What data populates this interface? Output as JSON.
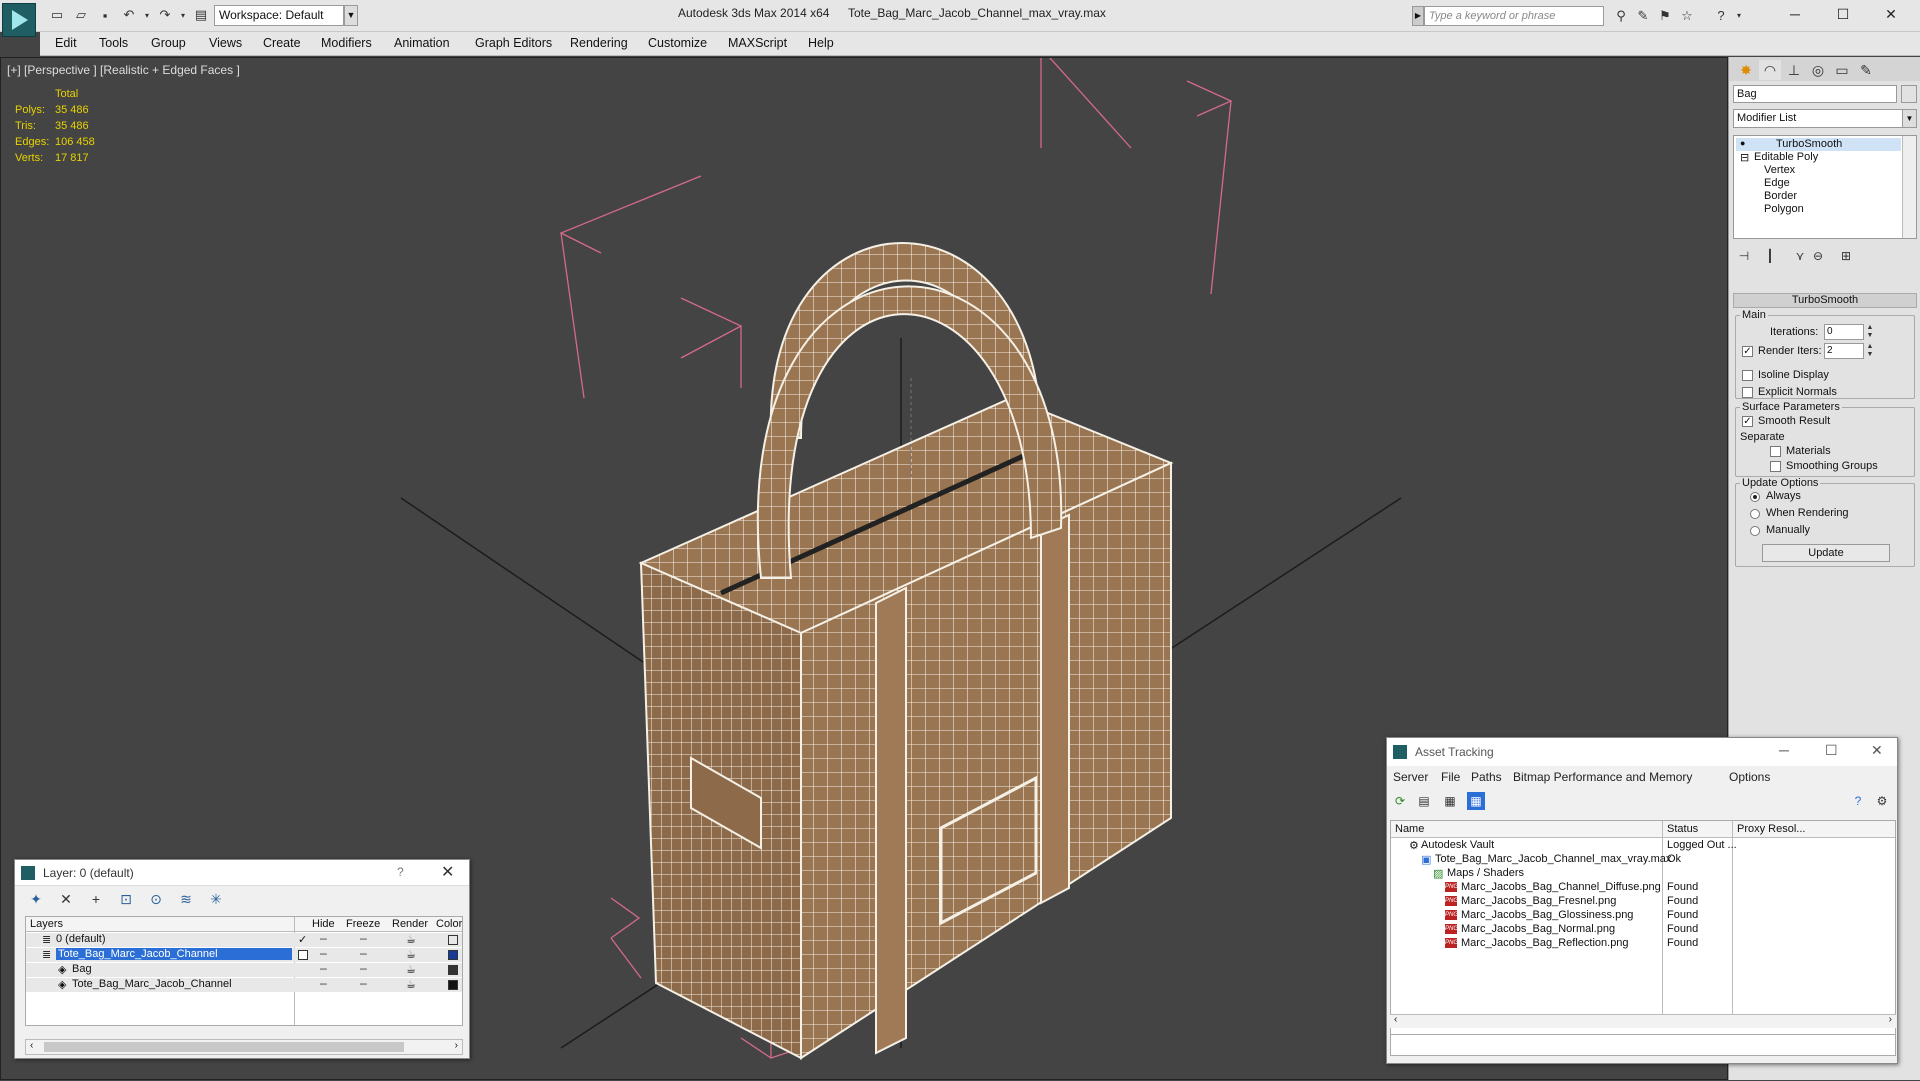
{
  "titlebar": {
    "workspace": "Workspace: Default",
    "app_title": "Autodesk 3ds Max  2014 x64",
    "doc_title": "Tote_Bag_Marc_Jacob_Channel_max_vray.max",
    "search_placeholder": "Type a keyword or phrase"
  },
  "menu": [
    "Edit",
    "Tools",
    "Group",
    "Views",
    "Create",
    "Modifiers",
    "Animation",
    "Graph Editors",
    "Rendering",
    "Customize",
    "MAXScript",
    "Help"
  ],
  "viewport": {
    "label": "[+] [Perspective ] [Realistic + Edged Faces ]",
    "stats_header": "Total",
    "stats": [
      {
        "k": "Polys:",
        "v": "35 486"
      },
      {
        "k": "Tris:",
        "v": "35 486"
      },
      {
        "k": "Edges:",
        "v": "106 458"
      },
      {
        "k": "Verts:",
        "v": "17 817"
      }
    ],
    "colors": {
      "bag": "#9a7552",
      "wire": "#f5f0e6",
      "bbox": "#d46a8a",
      "grid": "#1c1c1c"
    }
  },
  "command_panel": {
    "object_name": "Bag",
    "modifier_list": "Modifier List",
    "stack": [
      "TurboSmooth",
      "Editable Poly",
      "Vertex",
      "Edge",
      "Border",
      "Polygon"
    ],
    "rollout_title": "TurboSmooth",
    "main_label": "Main",
    "iterations_label": "Iterations:",
    "iterations_value": "0",
    "render_iters_label": "Render Iters:",
    "render_iters_value": "2",
    "isoline_label": "Isoline Display",
    "explicit_label": "Explicit Normals",
    "surface_label": "Surface Parameters",
    "smooth_result_label": "Smooth Result",
    "separate_label": "Separate",
    "materials_label": "Materials",
    "smoothing_groups_label": "Smoothing Groups",
    "update_options_label": "Update Options",
    "always_label": "Always",
    "when_rendering_label": "When Rendering",
    "manually_label": "Manually",
    "update_button": "Update"
  },
  "layer_window": {
    "title": "Layer: 0 (default)",
    "help": "?",
    "columns": [
      "Layers",
      "Hide",
      "Freeze",
      "Render",
      "Color"
    ],
    "rows": [
      {
        "name": "0 (default)",
        "indent": 0,
        "color": "#e8e8e8",
        "check": true
      },
      {
        "name": "Tote_Bag_Marc_Jacob_Channel",
        "indent": 0,
        "color": "#1a3a9a",
        "selected": true
      },
      {
        "name": "Bag",
        "indent": 1,
        "color": "#333333"
      },
      {
        "name": "Tote_Bag_Marc_Jacob_Channel",
        "indent": 1,
        "color": "#111111"
      }
    ]
  },
  "asset_window": {
    "title": "Asset Tracking",
    "menu": [
      "Server",
      "File",
      "Paths",
      "Bitmap Performance and Memory",
      "Options"
    ],
    "columns": [
      "Name",
      "Status",
      "Proxy Resol..."
    ],
    "rows": [
      {
        "name": "Autodesk Vault",
        "status": "Logged Out ...",
        "indent": 1,
        "icon": "vault-icon"
      },
      {
        "name": "Tote_Bag_Marc_Jacob_Channel_max_vray.max",
        "status": "Ok",
        "indent": 2,
        "icon": "max-file-icon"
      },
      {
        "name": "Maps / Shaders",
        "status": "",
        "indent": 3,
        "icon": "maps-icon"
      },
      {
        "name": "Marc_Jacobs_Bag_Channel_Diffuse.png",
        "status": "Found",
        "indent": 4,
        "icon": "png-icon"
      },
      {
        "name": "Marc_Jacobs_Bag_Fresnel.png",
        "status": "Found",
        "indent": 4,
        "icon": "png-icon"
      },
      {
        "name": "Marc_Jacobs_Bag_Glossiness.png",
        "status": "Found",
        "indent": 4,
        "icon": "png-icon"
      },
      {
        "name": "Marc_Jacobs_Bag_Normal.png",
        "status": "Found",
        "indent": 4,
        "icon": "png-icon"
      },
      {
        "name": "Marc_Jacobs_Bag_Reflection.png",
        "status": "Found",
        "indent": 4,
        "icon": "png-icon"
      }
    ]
  }
}
